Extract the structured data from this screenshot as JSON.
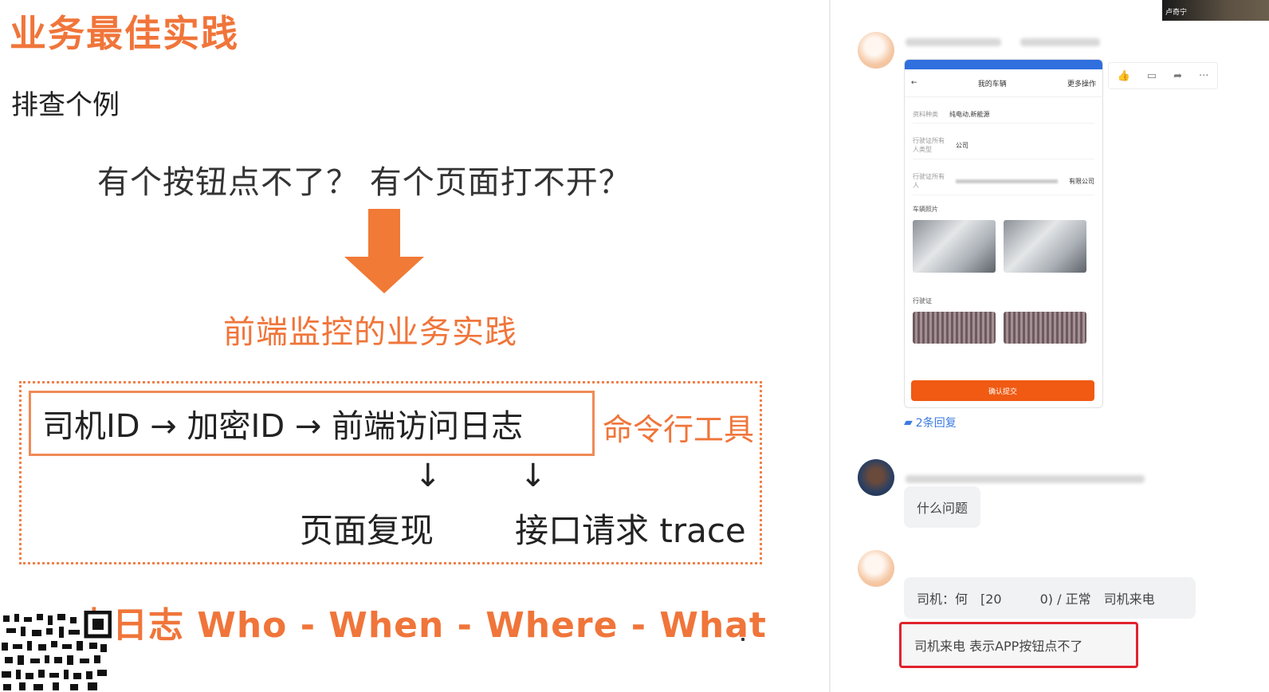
{
  "slide": {
    "title": "业务最佳实践",
    "subtitle": "排查个例",
    "question": "有个按钮点不了？ 有个页面打不开？",
    "practice": "前端监控的业务实践",
    "flow": "司机ID → 加密ID → 前端访问日志",
    "cli_tool": "命令行工具",
    "down_arrow": "↓",
    "page_replay": "页面复现",
    "api_trace": "接口请求 trace",
    "log_line": "查日志 Who - When - Where - What",
    "accent_color": "#f0753a"
  },
  "chat": {
    "reply_count": "2条回复",
    "message_question": "什么问题",
    "message_driver": "司机：何　[20　　　0) / 正常　司机来电",
    "message_highlight": "司机来电 表示APP按钮点不了",
    "phone_screen": {
      "header_title": "我的车辆",
      "header_action": "更多操作",
      "row1_label": "资料种类",
      "row1_value": "纯电动,新能源",
      "row2_label": "行驶证所有人类型",
      "row2_value": "公司",
      "row3_label": "行驶证所有人",
      "row3_value": "有限公司",
      "section_car_photos": "车辆照片",
      "section_license": "行驶证",
      "submit_button": "确认提交"
    },
    "actions": [
      "thumbs-up-icon",
      "comment-icon",
      "share-icon",
      "more-icon"
    ],
    "highlight_color": "#e0232d"
  },
  "video_thumb": {
    "label": "卢奇宁"
  }
}
